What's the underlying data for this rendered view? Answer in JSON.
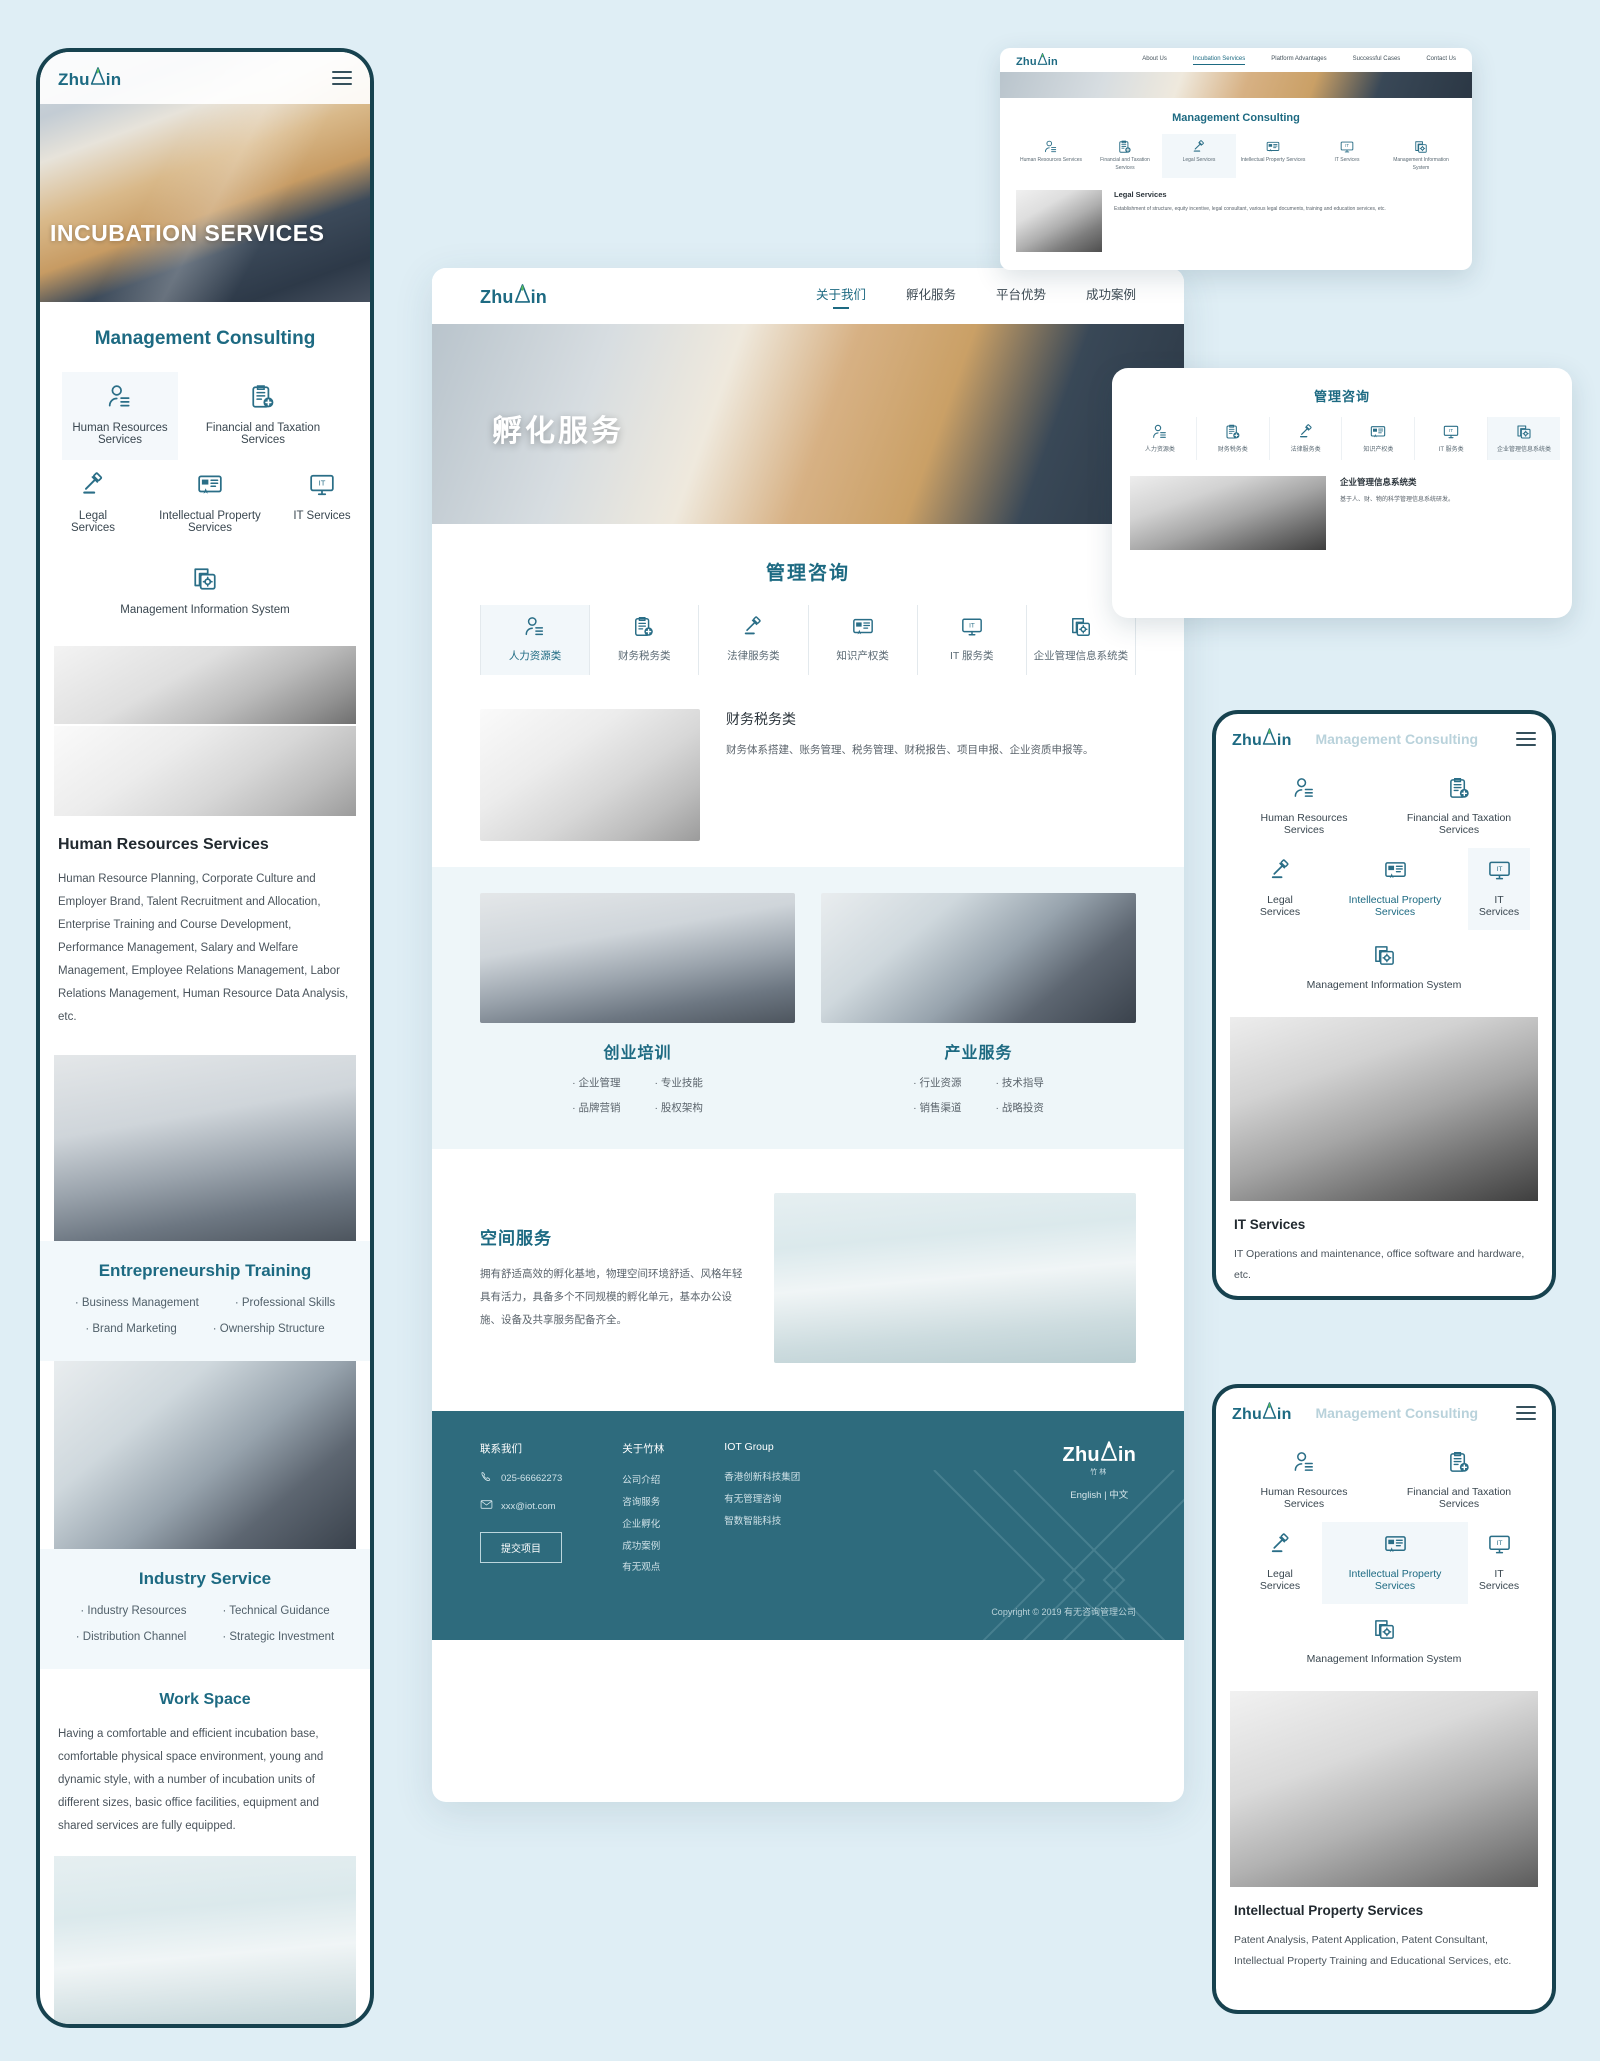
{
  "brand": {
    "name": "Zhulin",
    "logo_text_a": "Zhu",
    "logo_text_b": "in",
    "logo_sub": "竹林",
    "color": "#1d6a82",
    "accent_green": "#5bbf5a"
  },
  "page_bg": "#dfeef5",
  "mobile_main": {
    "menu_icon": "hamburger-icon",
    "hero_title": "INCUBATION SERVICES",
    "section_title": "Management Consulting",
    "services": [
      {
        "label": "Human Resources Services",
        "icon": "person-icon",
        "active": true
      },
      {
        "label": "Financial and Taxation Services",
        "icon": "clipboard-finance-icon",
        "active": false
      },
      {
        "label": "Legal Services",
        "icon": "gavel-icon",
        "active": false
      },
      {
        "label": "Intellectual Property Services",
        "icon": "certificate-icon",
        "active": false
      },
      {
        "label": "IT Services",
        "icon": "monitor-it-icon",
        "active": false
      },
      {
        "label": "Management Information System",
        "icon": "system-gear-icon",
        "active": false
      }
    ],
    "detail": {
      "title": "Human Resources Services",
      "body": "Human Resource Planning, Corporate Culture and Employer Brand, Talent Recruitment and Allocation, Enterprise Training and Course Development, Performance Management, Salary and Welfare Management, Employee Relations Management, Labor Relations Management, Human Resource Data Analysis, etc."
    },
    "training": {
      "title": "Entrepreneurship Training",
      "items": [
        "Business Management",
        "Professional Skills",
        "Brand Marketing",
        "Ownership Structure"
      ]
    },
    "industry": {
      "title": "Industry Service",
      "items": [
        "Industry Resources",
        "Technical Guidance",
        "Distribution Channel",
        "Strategic Investment"
      ]
    },
    "workspace": {
      "title": "Work Space",
      "body": "Having a comfortable and efficient incubation base, comfortable physical space environment, young and dynamic style, with a number of incubation units of different sizes, basic office facilities, equipment and shared services are fully equipped."
    }
  },
  "desktop": {
    "nav": [
      {
        "label": "关于我们",
        "active": true
      },
      {
        "label": "孵化服务",
        "active": false
      },
      {
        "label": "平台优势",
        "active": false
      },
      {
        "label": "成功案例",
        "active": false
      }
    ],
    "hero_title": "孵化服务",
    "section_title": "管理咨询",
    "tabs": [
      {
        "label": "人力资源类",
        "icon": "person-icon",
        "active": true
      },
      {
        "label": "财务税务类",
        "icon": "clipboard-finance-icon",
        "active": false
      },
      {
        "label": "法律服务类",
        "icon": "gavel-icon",
        "active": false
      },
      {
        "label": "知识产权类",
        "icon": "certificate-icon",
        "active": false
      },
      {
        "label": "IT 服务类",
        "icon": "monitor-it-icon",
        "active": false
      },
      {
        "label": "企业管理信息系统类",
        "icon": "system-gear-icon",
        "active": false
      }
    ],
    "detail": {
      "title": "财务税务类",
      "body": "财务体系搭建、账务管理、税务管理、财税报告、项目申报、企业资质申报等。"
    },
    "training": {
      "title": "创业培训",
      "col_a": [
        "企业管理",
        "品牌营销"
      ],
      "col_b": [
        "专业技能",
        "股权架构"
      ]
    },
    "industry": {
      "title": "产业服务",
      "col_a": [
        "行业资源",
        "销售渠道"
      ],
      "col_b": [
        "技术指导",
        "战略投资"
      ]
    },
    "space": {
      "title": "空间服务",
      "body": "拥有舒适高效的孵化基地，物理空间环境舒适、风格年轻具有活力，具备多个不同规模的孵化单元，基本办公设施、设备及共享服务配备齐全。"
    },
    "footer": {
      "contact_title": "联系我们",
      "phone": "025-66662273",
      "phone_icon": "phone-icon",
      "email": "xxx@iot.com",
      "email_icon": "mail-icon",
      "submit_label": "提交项目",
      "about_title": "关于竹林",
      "about_links": [
        "公司介绍",
        "咨询服务",
        "企业孵化",
        "成功案例",
        "有无观点"
      ],
      "group_title": "IOT Group",
      "group_links": [
        "香港创新科技集团",
        "有无管理咨询",
        "智数智能科技"
      ],
      "lang_en": "English",
      "lang_divider": "|",
      "lang_cn": "中文",
      "copyright": "Copyright © 2019 有无咨询管理公司"
    }
  },
  "card_en": {
    "nav": [
      {
        "label": "About Us",
        "active": false
      },
      {
        "label": "Incubation Services",
        "active": true
      },
      {
        "label": "Platform Advantages",
        "active": false
      },
      {
        "label": "Successful Cases",
        "active": false
      },
      {
        "label": "Contact Us",
        "active": false
      }
    ],
    "section_title": "Management Consulting",
    "tabs": [
      {
        "label": "Human Resources Services",
        "icon": "person-icon",
        "active": false
      },
      {
        "label": "Financial and Taxation Services",
        "icon": "clipboard-finance-icon",
        "active": false
      },
      {
        "label": "Legal Services",
        "icon": "gavel-icon",
        "active": true
      },
      {
        "label": "Intellectual Property Services",
        "icon": "certificate-icon",
        "active": false
      },
      {
        "label": "IT Services",
        "icon": "monitor-it-icon",
        "active": false
      },
      {
        "label": "Management Information System",
        "icon": "system-gear-icon",
        "active": false
      }
    ],
    "detail": {
      "title": "Legal Services",
      "body": "Establishment of structure, equity incentive, legal consultant, various legal documents, training and education services, etc."
    }
  },
  "card_cn": {
    "section_title": "管理咨询",
    "tabs": [
      {
        "label": "人力资源类",
        "icon": "person-icon",
        "active": false
      },
      {
        "label": "财务税务类",
        "icon": "clipboard-finance-icon",
        "active": false
      },
      {
        "label": "法律服务类",
        "icon": "gavel-icon",
        "active": false
      },
      {
        "label": "知识产权类",
        "icon": "certificate-icon",
        "active": false
      },
      {
        "label": "IT 服务类",
        "icon": "monitor-it-icon",
        "active": false
      },
      {
        "label": "企业管理信息系统类",
        "icon": "system-gear-icon",
        "active": true
      }
    ],
    "detail": {
      "title": "企业管理信息系统类",
      "body": "基于人、财、物的科学管理信息系统研发。"
    }
  },
  "mobile_it": {
    "ghost_title": "Management Consulting",
    "menu_icon": "hamburger-icon",
    "services": [
      {
        "label": "Human Resources Services",
        "icon": "person-icon",
        "active": false
      },
      {
        "label": "Financial and Taxation Services",
        "icon": "clipboard-finance-icon",
        "active": false
      },
      {
        "label": "Legal Services",
        "icon": "gavel-icon",
        "active": false
      },
      {
        "label": "Intellectual Property Services",
        "icon": "certificate-icon",
        "active": false
      },
      {
        "label": "IT Services",
        "icon": "monitor-it-icon",
        "active": true
      },
      {
        "label": "Management Information System",
        "icon": "system-gear-icon",
        "active": false
      }
    ],
    "detail": {
      "title": "IT Services",
      "body": "IT Operations and maintenance, office software and hardware, etc."
    }
  },
  "mobile_ip": {
    "ghost_title": "Management Consulting",
    "menu_icon": "hamburger-icon",
    "services": [
      {
        "label": "Human Resources Services",
        "icon": "person-icon",
        "active": false
      },
      {
        "label": "Financial and Taxation Services",
        "icon": "clipboard-finance-icon",
        "active": false
      },
      {
        "label": "Legal Services",
        "icon": "gavel-icon",
        "active": false
      },
      {
        "label": "Intellectual Property Services",
        "icon": "certificate-icon",
        "active": true
      },
      {
        "label": "IT Services",
        "icon": "monitor-it-icon",
        "active": false
      },
      {
        "label": "Management Information System",
        "icon": "system-gear-icon",
        "active": false
      }
    ],
    "detail": {
      "title": "Intellectual Property Services",
      "body": "Patent Analysis, Patent Application, Patent Consultant, Intellectual Property Training and Educational Services, etc."
    }
  }
}
